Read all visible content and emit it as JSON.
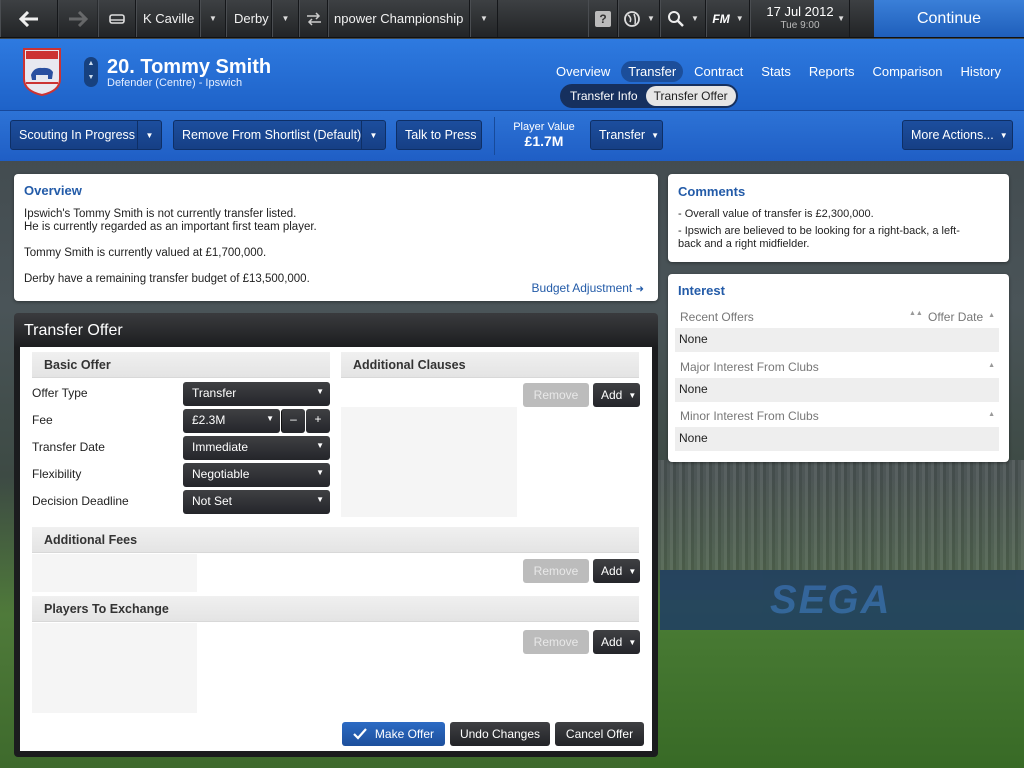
{
  "topbar": {
    "manager": "K Caville",
    "club": "Derby",
    "competition": "npower Championship",
    "fm_label": "FM",
    "date": "17 Jul 2012",
    "time": "Tue 9:00",
    "continue_label": "Continue"
  },
  "player": {
    "name": "20. Tommy Smith",
    "position_club": "Defender (Centre) - Ipswich"
  },
  "nav": {
    "tabs": [
      "Overview",
      "Transfer",
      "Contract",
      "Stats",
      "Reports",
      "Comparison",
      "History"
    ],
    "active": "Transfer",
    "subtabs": [
      "Transfer Info",
      "Transfer Offer"
    ],
    "active_subtab": "Transfer Offer"
  },
  "actions": {
    "scouting": "Scouting In Progress",
    "shortlist": "Remove From Shortlist (Default)",
    "talk_press": "Talk to Press",
    "value_label": "Player Value",
    "value": "£1.7M",
    "transfer": "Transfer",
    "more": "More Actions..."
  },
  "overview": {
    "title": "Overview",
    "line1": "Ipswich's Tommy Smith is not currently transfer listed.",
    "line2": "He is currently regarded as an important first team player.",
    "line3": "Tommy Smith is currently valued at £1,700,000.",
    "line4": "Derby have a remaining transfer budget of £13,500,000.",
    "budget_link": "Budget Adjustment"
  },
  "comments": {
    "title": "Comments",
    "items": [
      "- Overall value of transfer is £2,300,000.",
      "- Ipswich are believed to be looking for a right-back, a left-back and a right midfielder."
    ]
  },
  "interest": {
    "title": "Interest",
    "recent_offers": "Recent Offers",
    "offer_date": "Offer Date",
    "recent_value": "None",
    "major": "Major Interest From Clubs",
    "major_value": "None",
    "minor": "Minor Interest From Clubs",
    "minor_value": "None"
  },
  "offer": {
    "title": "Transfer Offer",
    "basic_title": "Basic Offer",
    "clauses_title": "Additional Clauses",
    "fees_title": "Additional Fees",
    "exchange_title": "Players To Exchange",
    "fields": [
      {
        "label": "Offer Type",
        "value": "Transfer"
      },
      {
        "label": "Fee",
        "value": "£2.3M"
      },
      {
        "label": "Transfer Date",
        "value": "Immediate"
      },
      {
        "label": "Flexibility",
        "value": "Negotiable"
      },
      {
        "label": "Decision Deadline",
        "value": "Not Set"
      }
    ],
    "remove_label": "Remove",
    "add_label": "Add",
    "make_offer": "Make Offer",
    "undo": "Undo Changes",
    "cancel": "Cancel Offer"
  },
  "background": {
    "adboard_text": "SEGA"
  }
}
